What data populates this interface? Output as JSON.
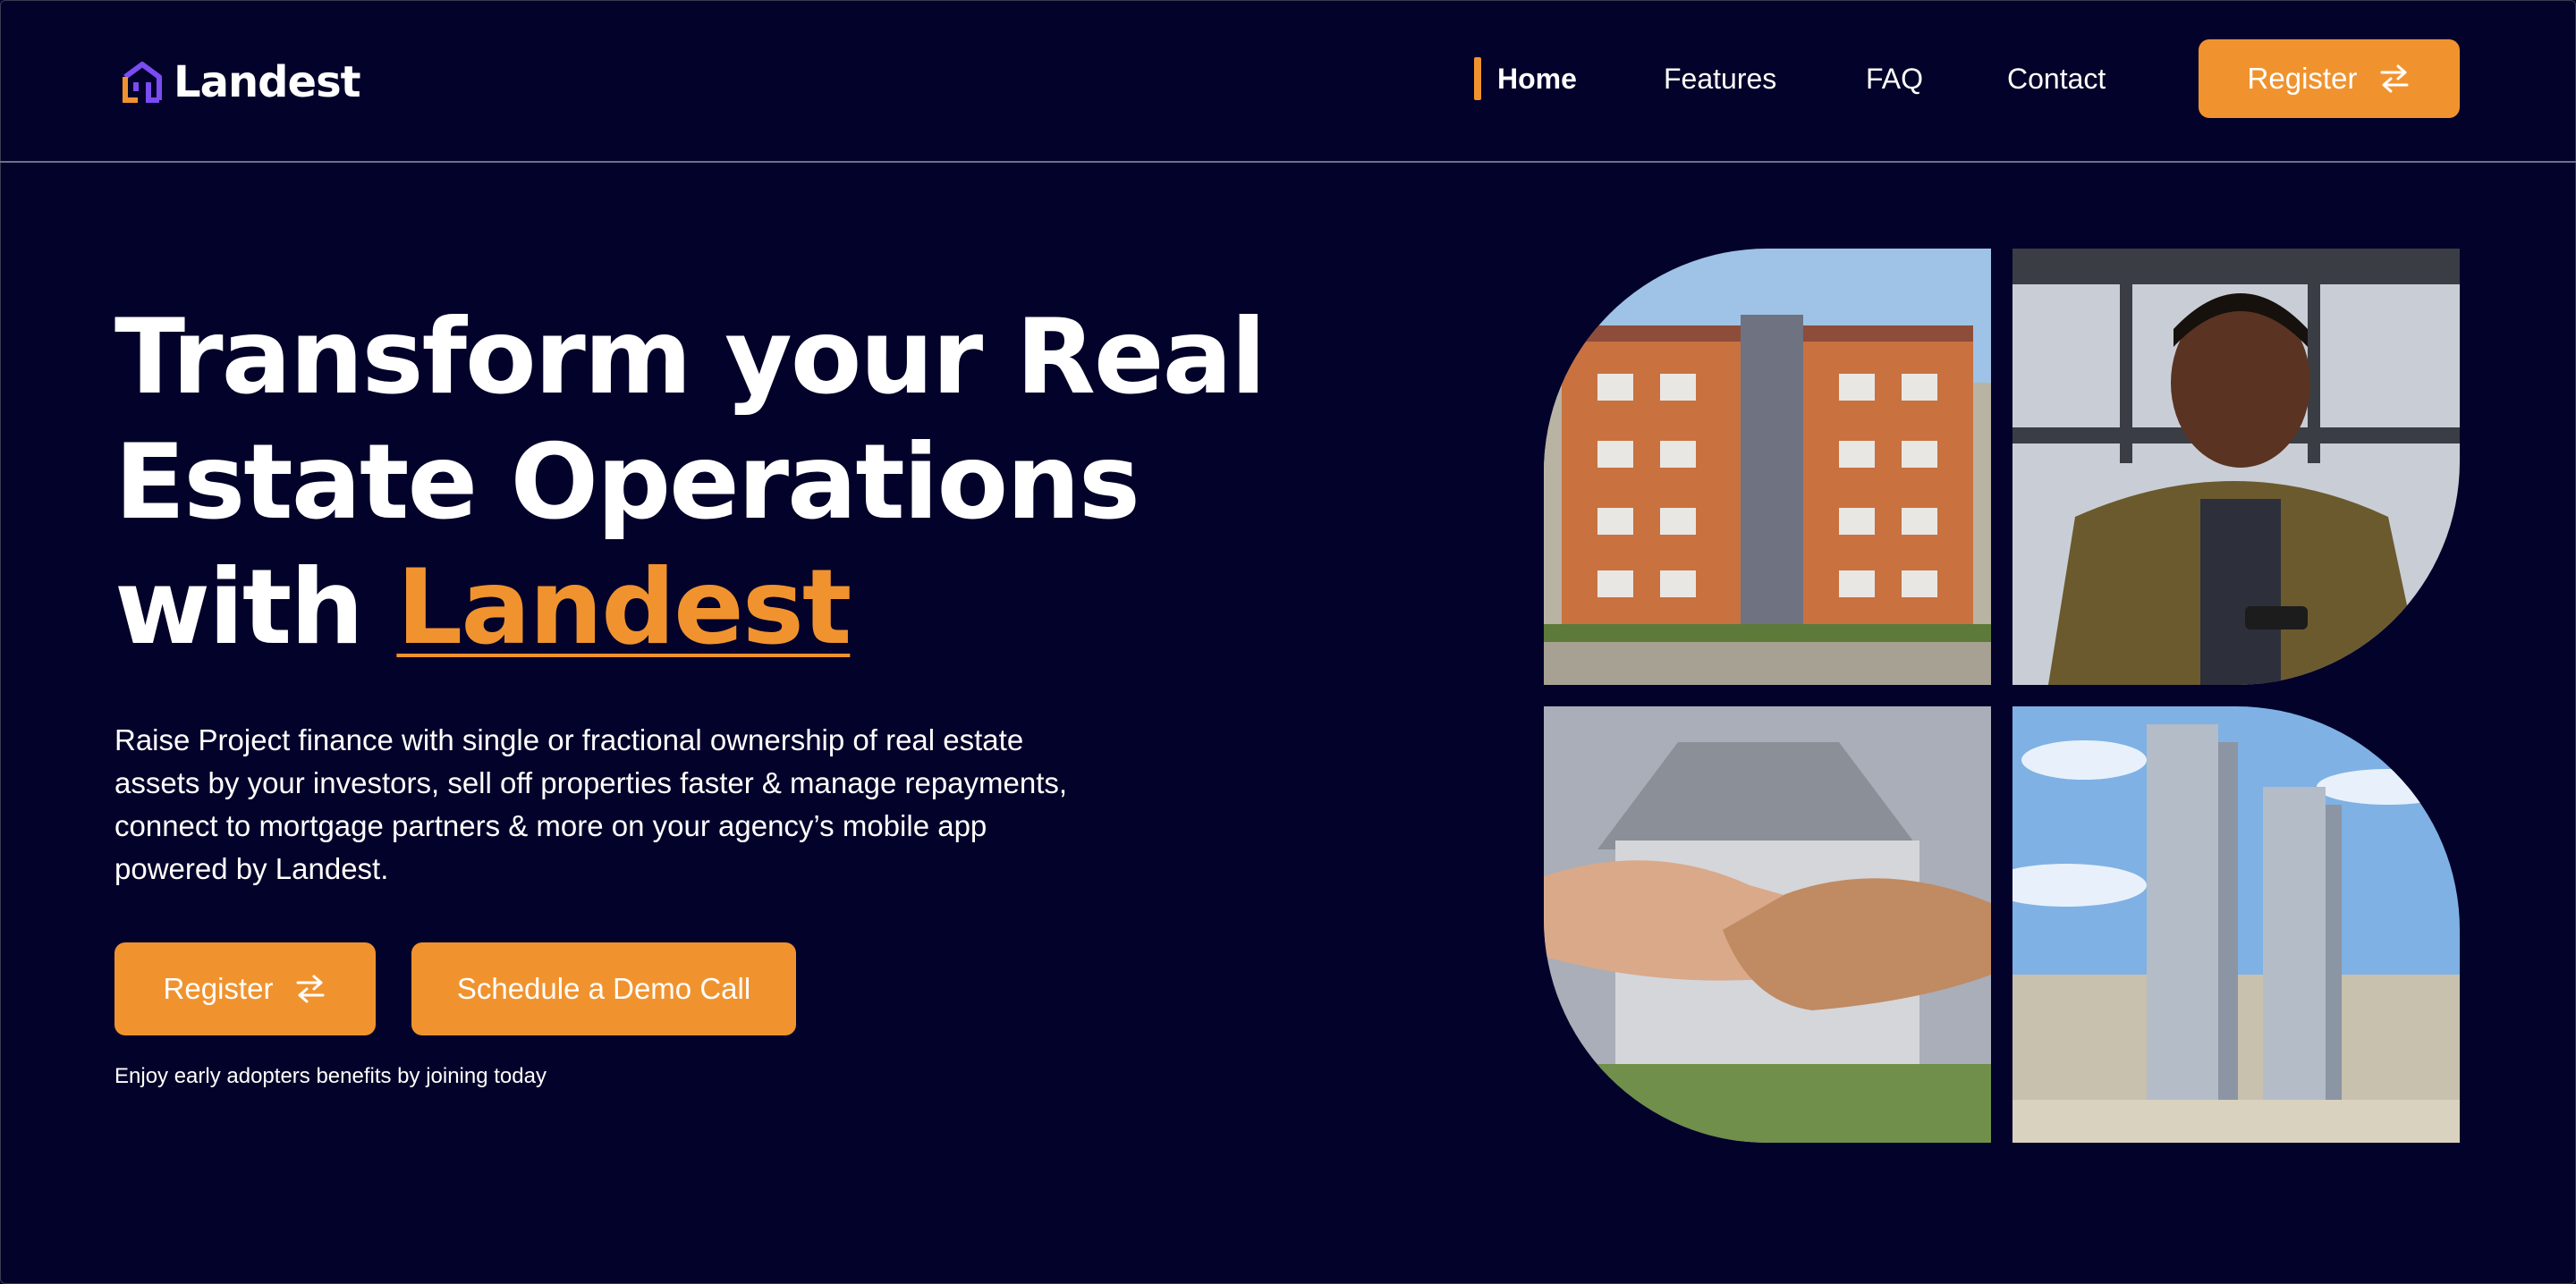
{
  "brand": {
    "name": "Landest",
    "accent_color": "#f0932f",
    "background_color": "#03022a",
    "logo_icon": "house-logo-icon"
  },
  "nav": {
    "items": [
      {
        "label": "Home",
        "active": true
      },
      {
        "label": "Features",
        "active": false
      },
      {
        "label": "FAQ",
        "active": false
      },
      {
        "label": "Contact",
        "active": false
      }
    ],
    "register_label": "Register",
    "register_icon": "swap-arrows-icon"
  },
  "hero": {
    "headline_line1": "Transform your Real",
    "headline_line2": "Estate Operations",
    "headline_line3_prefix": "with",
    "headline_highlight": "Landest",
    "lead": "Raise Project finance with single or fractional ownership of real estate assets by your investors, sell off properties faster & manage repayments, connect to mortgage partners & more on your agency’s mobile app powered by Landest.",
    "register_label": "Register",
    "register_icon": "swap-arrows-icon",
    "demo_label": "Schedule a Demo Call",
    "note": "Enjoy early adopters benefits by joining today"
  },
  "gallery": [
    {
      "image": "apartment-building-photo"
    },
    {
      "image": "smiling-man-with-phone-photo"
    },
    {
      "image": "handshake-photo"
    },
    {
      "image": "twin-towers-photo"
    }
  ]
}
